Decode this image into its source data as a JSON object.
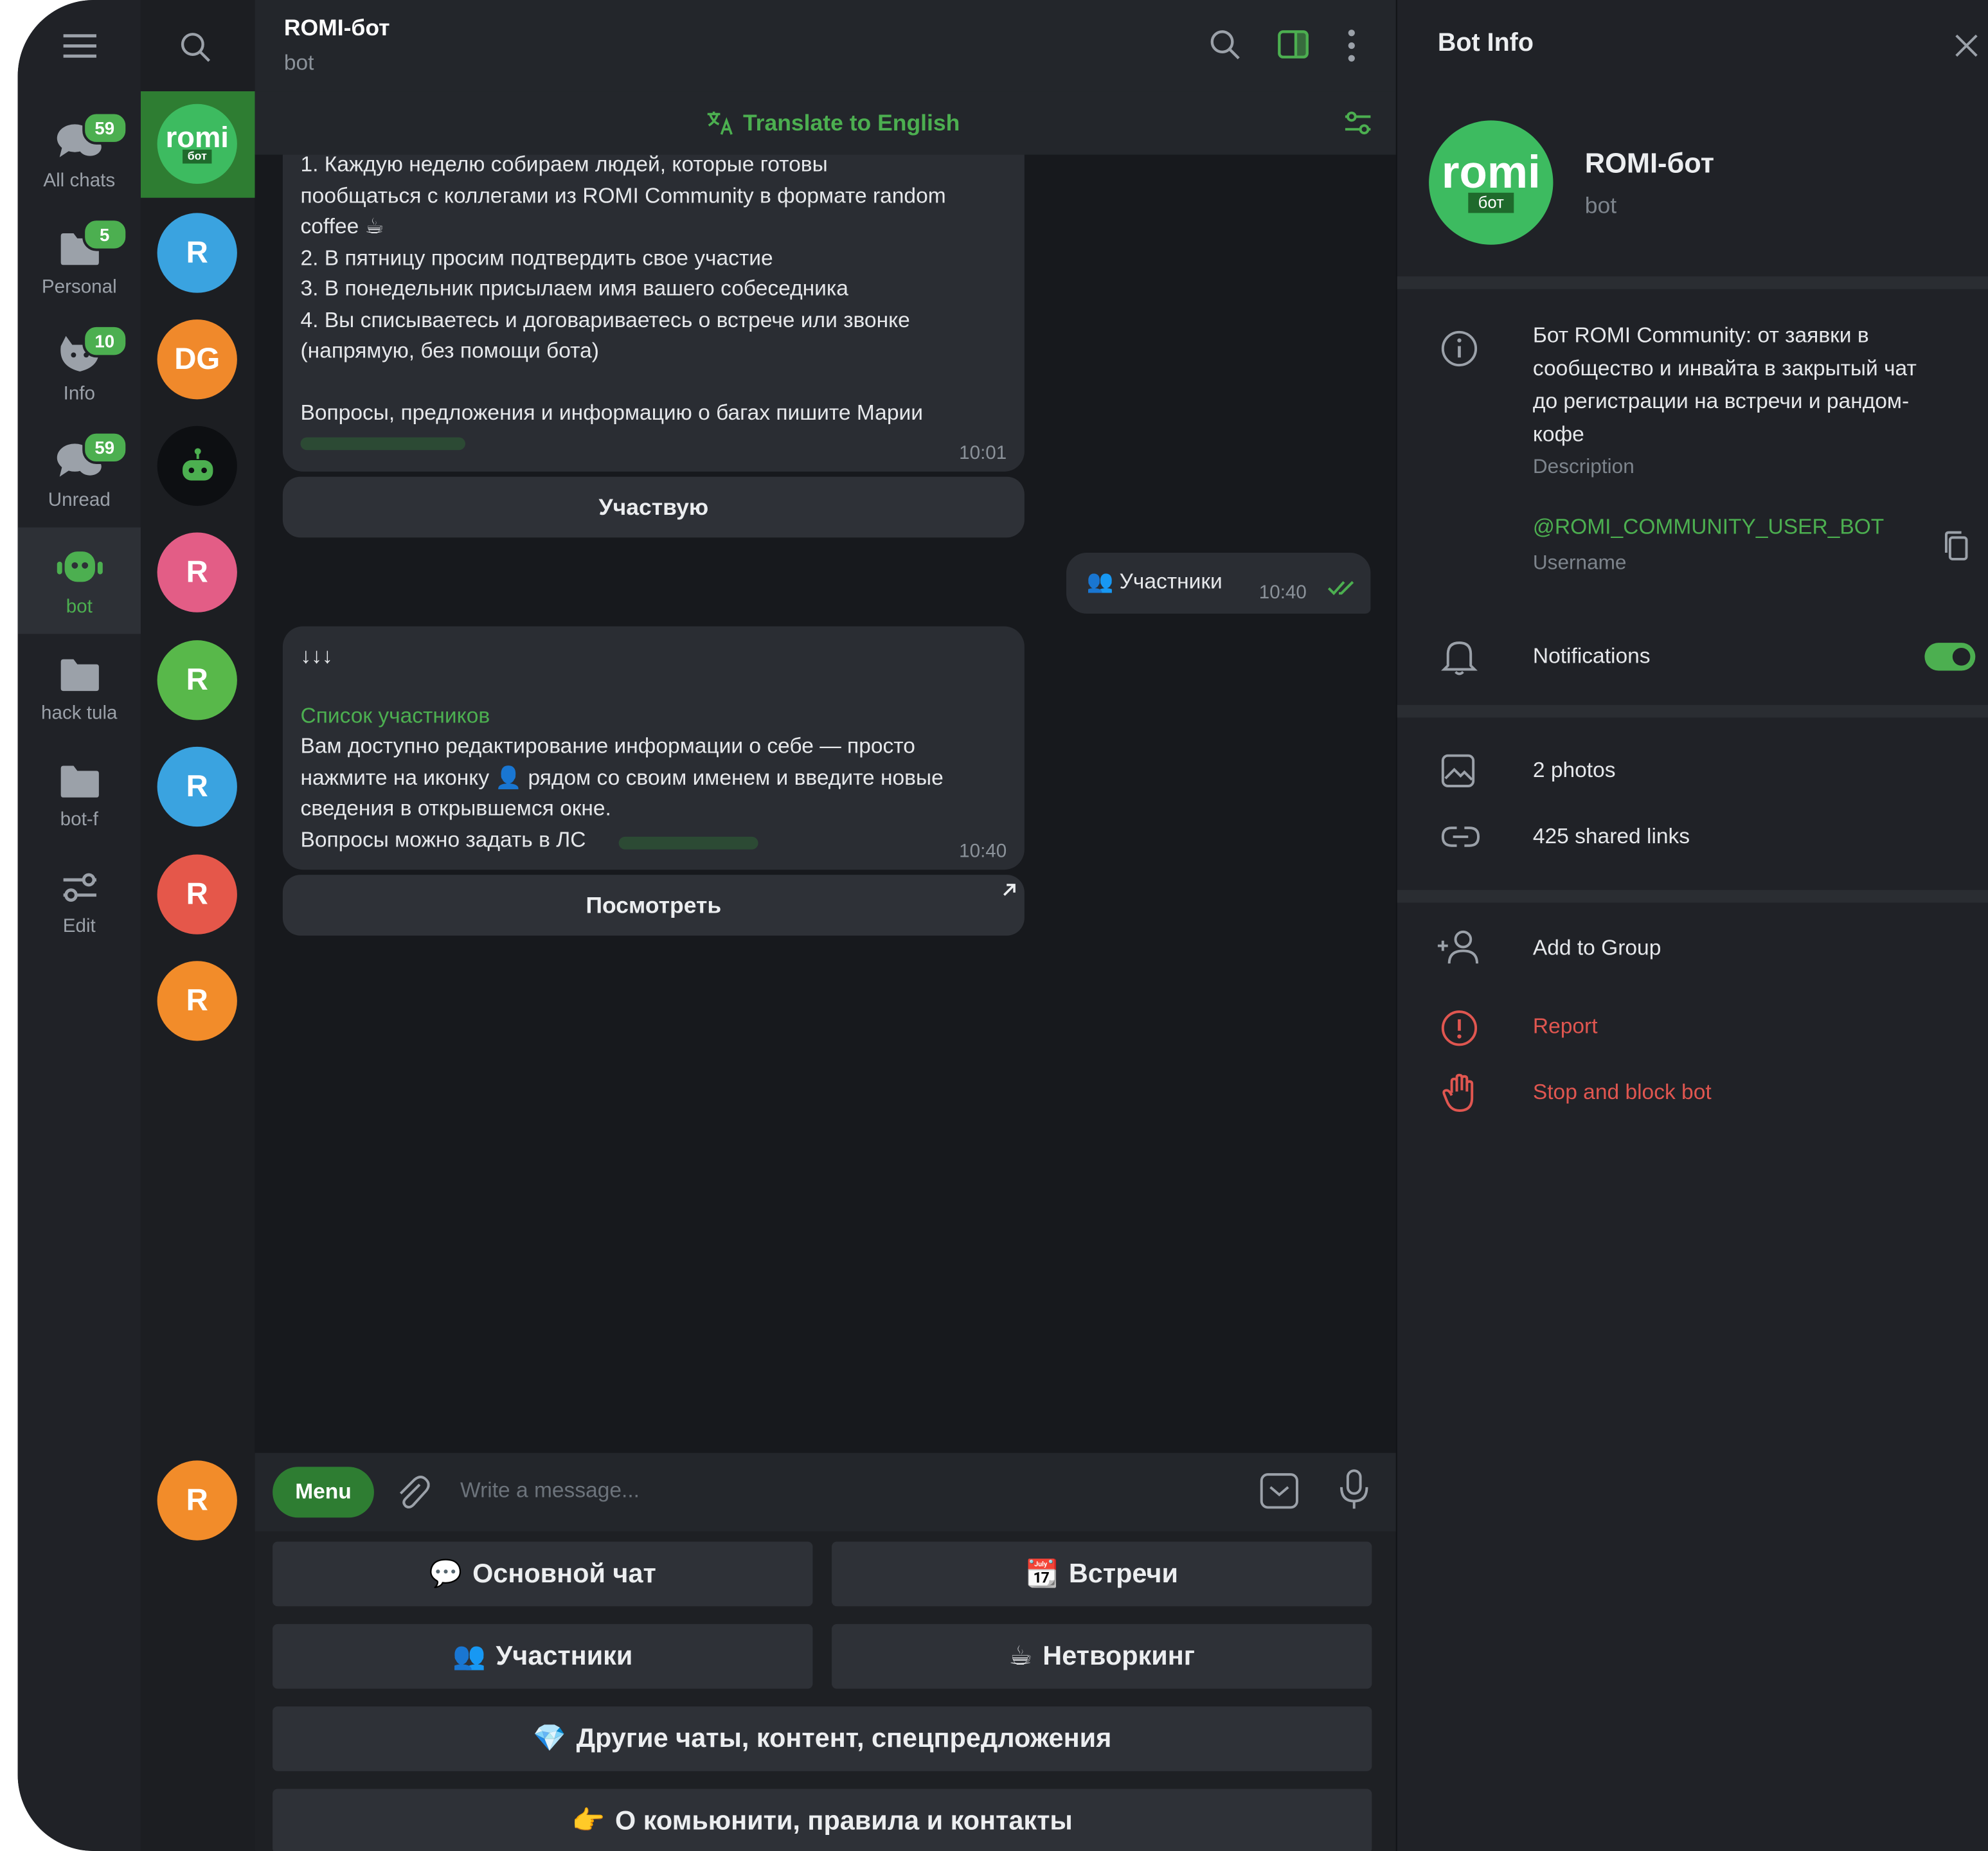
{
  "colors": {
    "accent": "#4caf50",
    "danger": "#e05650",
    "bg": "#17191d",
    "panel": "#202227"
  },
  "folders": [
    {
      "label": "All chats",
      "badge": "59",
      "icon": "chats-icon"
    },
    {
      "label": "Personal",
      "badge": "5",
      "icon": "folder-icon"
    },
    {
      "label": "Info",
      "badge": "10",
      "icon": "cat-icon"
    },
    {
      "label": "Unread",
      "badge": "59",
      "icon": "chats-icon"
    },
    {
      "label": "bot",
      "badge": "",
      "icon": "bot-icon",
      "active": true
    },
    {
      "label": "hack tula",
      "badge": "",
      "icon": "folder-icon"
    },
    {
      "label": "bot-f",
      "badge": "",
      "icon": "folder-icon"
    },
    {
      "label": "Edit",
      "badge": "",
      "icon": "sliders-icon"
    }
  ],
  "chat_avatars": [
    {
      "text": "romi",
      "sub": "бот",
      "color": "#3dbb60"
    },
    {
      "text": "R",
      "color": "#3aa3e0"
    },
    {
      "text": "DG",
      "color": "#f0892b"
    },
    {
      "text": "",
      "color": "#0d0f12",
      "icon": "robot-icon"
    },
    {
      "text": "R",
      "color": "#e35d86"
    },
    {
      "text": "R",
      "color": "#58b84a"
    },
    {
      "text": "R",
      "color": "#3aa3e0"
    },
    {
      "text": "R",
      "color": "#e5574a"
    },
    {
      "text": "R",
      "color": "#f28c2a"
    },
    {
      "text": "R",
      "color": "#f28c2a"
    }
  ],
  "chat": {
    "title": "ROMI-бот",
    "subtitle": "bot",
    "translate": "Translate to English",
    "msg1": {
      "lines": [
        "1. Каждую неделю собираем людей, которые готовы",
        "пообщаться с коллегами из ROMI Community в формате random",
        "coffee ☕",
        "2. В пятницу просим подтвердить свое участие",
        "3. В понедельник присылаем имя вашего собеседника",
        "4. Вы списываетесь и договариваетесь о встрече или звонке",
        "(напрямую, без помощи бота)",
        "",
        "Вопросы, предложения и информацию о багах пишите Марии"
      ],
      "time": "10:01",
      "button": "Участвую"
    },
    "outgoing": {
      "text": "👥 Участники",
      "time": "10:40"
    },
    "msg2": {
      "arrows": "↓↓↓",
      "link": "Список участников",
      "lines": [
        "Вам доступно редактирование информации о себе — просто",
        "нажмите на иконку 👤 рядом со своим именем и введите новые",
        "сведения в открывшемся окне.",
        "Вопросы можно задать в ЛС"
      ],
      "time": "10:40",
      "button": "Посмотреть"
    },
    "input": {
      "menu": "Menu",
      "placeholder": "Write a message..."
    },
    "keyboard": [
      {
        "emoji": "💬",
        "label": "Основной чат"
      },
      {
        "emoji": "📆",
        "label": "Встречи"
      },
      {
        "emoji": "👥",
        "label": "Участники"
      },
      {
        "emoji": "☕",
        "label": "Нетворкинг"
      },
      {
        "emoji": "💎",
        "label": "Другие чаты, контент, спецпредложения"
      },
      {
        "emoji": "👉",
        "label": "О комьюнити, правила и контакты"
      }
    ]
  },
  "info": {
    "header": "Bot Info",
    "name": "ROMI-бот",
    "type": "bot",
    "avatar_text": "romi",
    "avatar_sub": "бот",
    "description": [
      "Бот ROMI Community: от заявки в",
      "сообщество и инвайта в закрытый чат",
      "до регистрации на встречи и рандом-",
      "кофе"
    ],
    "description_label": "Description",
    "username": "@ROMI_COMMUNITY_USER_BOT",
    "username_label": "Username",
    "notifications": "Notifications",
    "notifications_on": true,
    "photos": "2 photos",
    "links": "425 shared links",
    "add_group": "Add to Group",
    "report": "Report",
    "block": "Stop and block bot"
  }
}
